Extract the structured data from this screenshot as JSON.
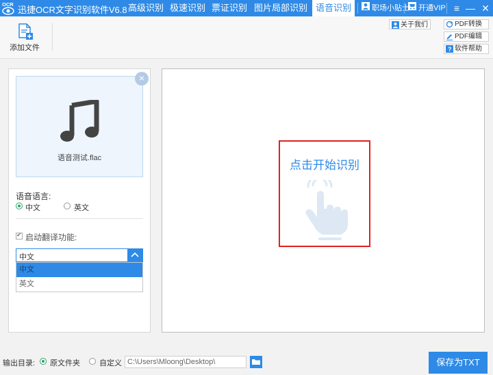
{
  "titlebar": {
    "logo_text": "OCR",
    "app_title": "迅捷OCR文字识别软件V6.8",
    "tabs": [
      {
        "label": "高级识别"
      },
      {
        "label": "极速识别"
      },
      {
        "label": "票证识别"
      },
      {
        "label": "图片局部识别"
      },
      {
        "label": "语音识别",
        "active": true
      }
    ],
    "tips_link": "职场小贴士",
    "vip_link": "开通VIP",
    "accent_color": "#2e8ae6"
  },
  "toolbar": {
    "add_file_label": "添加文件",
    "about_label": "关于我们",
    "pdf_convert_label": "PDF转换",
    "pdf_edit_label": "PDF编辑",
    "help_label": "软件帮助"
  },
  "left_panel": {
    "file_name": "语音测试.flac",
    "language_label": "语音语言:",
    "language_options": [
      {
        "label": "中文",
        "checked": true
      },
      {
        "label": "英文",
        "checked": false
      }
    ],
    "translate_label": "启动翻译功能:",
    "translate_checked": true,
    "translate_select_value": "中文",
    "translate_options": [
      {
        "label": "中文",
        "selected": true
      },
      {
        "label": "英文",
        "selected": false
      }
    ]
  },
  "main_panel": {
    "start_label": "点击开始识别",
    "highlight_color": "#e02020"
  },
  "bottom_bar": {
    "output_label": "输出目录:",
    "output_options": [
      {
        "label": "原文件夹",
        "checked": true
      },
      {
        "label": "自定义",
        "checked": false
      }
    ],
    "path_value": "C:\\Users\\Mloong\\Desktop\\",
    "save_label": "保存为TXT"
  }
}
